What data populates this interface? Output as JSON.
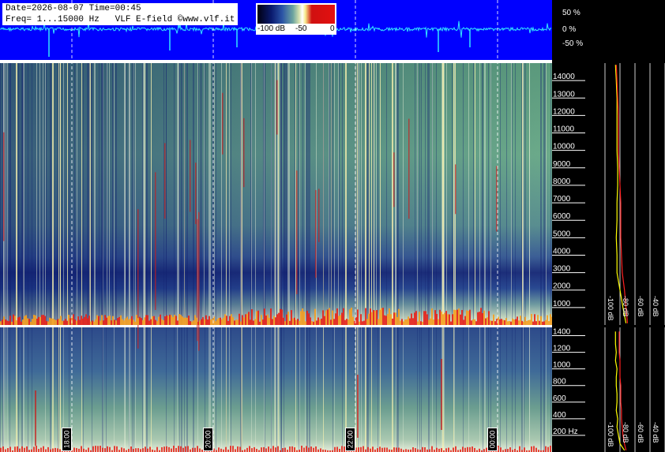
{
  "header": {
    "date_line": "Date=2026-08-07 Time=00:45",
    "freq_line": "Freq= 1...15000 Hz   VLF E-field ©www.vlf.it"
  },
  "colorbar": {
    "labels": [
      "-100 dB",
      "-50",
      "0"
    ]
  },
  "waveform": {
    "labels": [
      "50 %",
      "0 %",
      "-50 %"
    ],
    "background_color": "#0000ff",
    "trace_color": "#33e6ff"
  },
  "time_markers": [
    "18:00",
    "20:00",
    "22:00",
    "00:00"
  ],
  "chart_data": [
    {
      "type": "heatmap",
      "name": "spectrogram-upper",
      "y_unit": "Hz",
      "ylim": [
        0,
        15000
      ],
      "yticks": [
        1000,
        2000,
        3000,
        4000,
        5000,
        6000,
        7000,
        8000,
        9000,
        10000,
        11000,
        12000,
        13000,
        14000
      ],
      "ytick_labels": [
        "1000",
        "2000",
        "3000",
        "4000",
        "5000",
        "6000",
        "7000",
        "8000",
        "9000",
        "10000",
        "11000",
        "12000",
        "13000",
        "14000"
      ],
      "x_ticks": [
        "18:00",
        "20:00",
        "22:00",
        "00:00"
      ],
      "colorscale_db": [
        -100,
        0
      ],
      "colors": [
        "#000010",
        "#0a1a6e",
        "#2b54a6",
        "#6fa6a0",
        "#d8e3b0",
        "#ffffff",
        "#f6e88a",
        "#e31010"
      ]
    },
    {
      "type": "heatmap",
      "name": "spectrogram-lower",
      "y_unit": "Hz",
      "ylim": [
        0,
        1500
      ],
      "yticks": [
        200,
        400,
        600,
        800,
        1000,
        1200,
        1400
      ],
      "ytick_labels": [
        "200 Hz",
        "400",
        "600",
        "800",
        "1000",
        "1200",
        "1400"
      ],
      "x_ticks": [
        "18:00",
        "20:00",
        "22:00",
        "00:00"
      ],
      "colorscale_db": [
        -100,
        0
      ]
    },
    {
      "type": "line",
      "name": "spectrum-upper",
      "x_unit": "dB",
      "xlim": [
        -100,
        -20
      ],
      "x_tick_labels": [
        "-100 dB",
        "-80 dB",
        "-60 dB",
        "-40 dB",
        "-20 dB"
      ],
      "xticks": [
        -100,
        -80,
        -60,
        -40,
        -20
      ],
      "ylim": [
        0,
        15000
      ],
      "series": [
        {
          "color": "#ffff00",
          "x": [
            -72,
            -76,
            -80,
            -84,
            -84,
            -85,
            -84,
            -84,
            -83,
            -83,
            -84,
            -84,
            -84,
            -84,
            -85,
            -86
          ],
          "y": [
            100,
            1000,
            2000,
            3000,
            4000,
            5000,
            6000,
            7000,
            8000,
            9000,
            10000,
            11000,
            12000,
            13000,
            14000,
            14900
          ]
        },
        {
          "color": "#ff2020",
          "x": [
            -70,
            -72,
            -74,
            -77,
            -78,
            -79,
            -79,
            -79,
            -80,
            -81,
            -82,
            -82,
            -82,
            -83,
            -84,
            -85
          ],
          "y": [
            100,
            1000,
            2000,
            3000,
            4000,
            5000,
            6000,
            7000,
            8000,
            9000,
            10000,
            11000,
            12000,
            13000,
            14000,
            14900
          ]
        }
      ]
    },
    {
      "type": "line",
      "name": "spectrum-lower",
      "x_unit": "dB",
      "xlim": [
        -100,
        -20
      ],
      "x_tick_labels": [
        "-100 dB",
        "-80 dB",
        "-60 dB",
        "-40 dB",
        "-20 dB"
      ],
      "xticks": [
        -100,
        -80,
        -60,
        -40,
        -20
      ],
      "ylim": [
        0,
        1500
      ],
      "series": [
        {
          "color": "#ffff00",
          "x": [
            -74,
            -80,
            -82,
            -84,
            -83,
            -85,
            -84,
            -84,
            -85,
            -85,
            -84,
            -86,
            -85,
            -86,
            -86
          ],
          "y": [
            20,
            100,
            200,
            300,
            400,
            500,
            600,
            700,
            800,
            900,
            1000,
            1100,
            1200,
            1300,
            1450
          ]
        },
        {
          "color": "#ff2020",
          "x": [
            -72,
            -74,
            -76,
            -77,
            -78,
            -78,
            -79,
            -79,
            -79,
            -80,
            -80,
            -80,
            -81,
            -81,
            -81
          ],
          "y": [
            20,
            100,
            200,
            300,
            400,
            500,
            600,
            700,
            800,
            900,
            1000,
            1100,
            1200,
            1300,
            1450
          ]
        }
      ]
    }
  ]
}
